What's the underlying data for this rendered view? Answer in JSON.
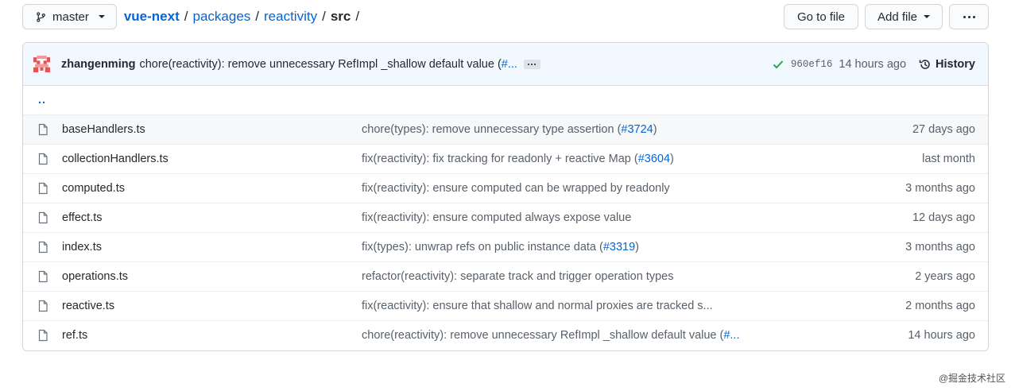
{
  "topbar": {
    "branch": "master",
    "breadcrumb": {
      "repo": "vue-next",
      "dir1": "packages",
      "dir2": "reactivity",
      "current": "src",
      "separator": "/"
    },
    "go_to_file": "Go to file",
    "add_file": "Add file"
  },
  "commit": {
    "author": "zhangenming",
    "message": "chore(reactivity): remove unnecessary RefImpl _shallow default value (",
    "message_link": "#...",
    "sha": "960ef16",
    "time": "14 hours ago",
    "history": "History"
  },
  "updir": "..",
  "files": [
    {
      "name": "baseHandlers.ts",
      "msg": "chore(types): remove unnecessary type assertion (",
      "link": "#3724",
      "msg_end": ")",
      "age": "27 days ago"
    },
    {
      "name": "collectionHandlers.ts",
      "msg": "fix(reactivity): fix tracking for readonly + reactive Map (",
      "link": "#3604",
      "msg_end": ")",
      "age": "last month"
    },
    {
      "name": "computed.ts",
      "msg": "fix(reactivity): ensure computed can be wrapped by readonly",
      "link": "",
      "msg_end": "",
      "age": "3 months ago"
    },
    {
      "name": "effect.ts",
      "msg": "fix(reactivity): ensure computed always expose value",
      "link": "",
      "msg_end": "",
      "age": "12 days ago"
    },
    {
      "name": "index.ts",
      "msg": "fix(types): unwrap refs on public instance data (",
      "link": "#3319",
      "msg_end": ")",
      "age": "3 months ago"
    },
    {
      "name": "operations.ts",
      "msg": "refactor(reactivity): separate track and trigger operation types",
      "link": "",
      "msg_end": "",
      "age": "2 years ago"
    },
    {
      "name": "reactive.ts",
      "msg": "fix(reactivity): ensure that shallow and normal proxies are tracked s...",
      "link": "",
      "msg_end": "",
      "age": "2 months ago"
    },
    {
      "name": "ref.ts",
      "msg": "chore(reactivity): remove unnecessary RefImpl _shallow default value (",
      "link": "#...",
      "msg_end": "",
      "age": "14 hours ago"
    }
  ],
  "watermark": "@掘金技术社区",
  "colors": {
    "link": "#0366d6",
    "check": "#28a745",
    "avatar": "#e55353"
  }
}
